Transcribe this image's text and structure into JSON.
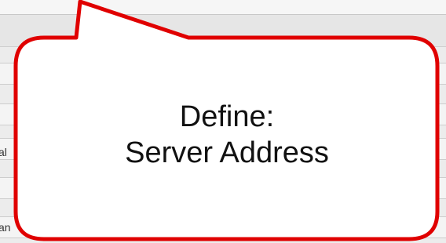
{
  "callout": {
    "line1": "Define:",
    "line2": "Server Address",
    "border_color": "#e00000",
    "fill_color": "#ffffff"
  },
  "background": {
    "partial_label_left_1": "al",
    "partial_label_left_2": "an"
  }
}
